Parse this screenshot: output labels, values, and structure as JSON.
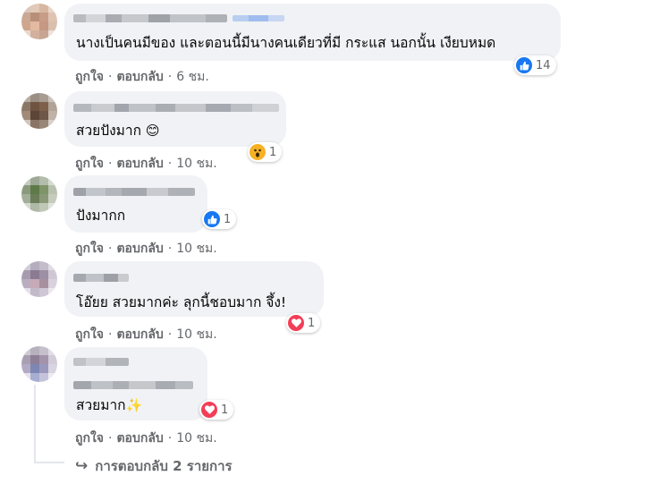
{
  "comments": [
    {
      "text": "นางเป็นคนมีของ และตอนนี้มีนางคนเดียวที่มี กระแส นอกนั้น เงียบหมด",
      "reaction": {
        "type": "like",
        "count": "14"
      },
      "like_label": "ถูกใจ",
      "reply_label": "ตอบกลับ",
      "time": "6 ชม."
    },
    {
      "text": "สวยปังมาก",
      "emoji": "😊",
      "reaction": {
        "type": "wow",
        "count": "1"
      },
      "like_label": "ถูกใจ",
      "reply_label": "ตอบกลับ",
      "time": "10 ชม."
    },
    {
      "text": "ปังมากก",
      "reaction": {
        "type": "like",
        "count": "1"
      },
      "like_label": "ถูกใจ",
      "reply_label": "ตอบกลับ",
      "time": "10 ชม."
    },
    {
      "text": "โอ๊ยย สวยมากค่ะ ลุกนี้ชอบมาก จึ้ง!",
      "reaction": {
        "type": "love",
        "count": "1"
      },
      "like_label": "ถูกใจ",
      "reply_label": "ตอบกลับ",
      "time": "10 ชม."
    },
    {
      "text": "สวยมาก",
      "emoji": "✨",
      "reaction": {
        "type": "love",
        "count": "1"
      },
      "like_label": "ถูกใจ",
      "reply_label": "ตอบกลับ",
      "time": "10 ชม."
    }
  ],
  "separator": "·",
  "view_replies": {
    "arrow": "↪",
    "label": "การตอบกลับ 2 รายการ"
  },
  "colors": {
    "bubble": "#f0f2f5",
    "meta_text": "#65676b",
    "like_blue": "#1877f2",
    "love_red": "#f33e58",
    "wow_yellow": "#f7b125"
  }
}
